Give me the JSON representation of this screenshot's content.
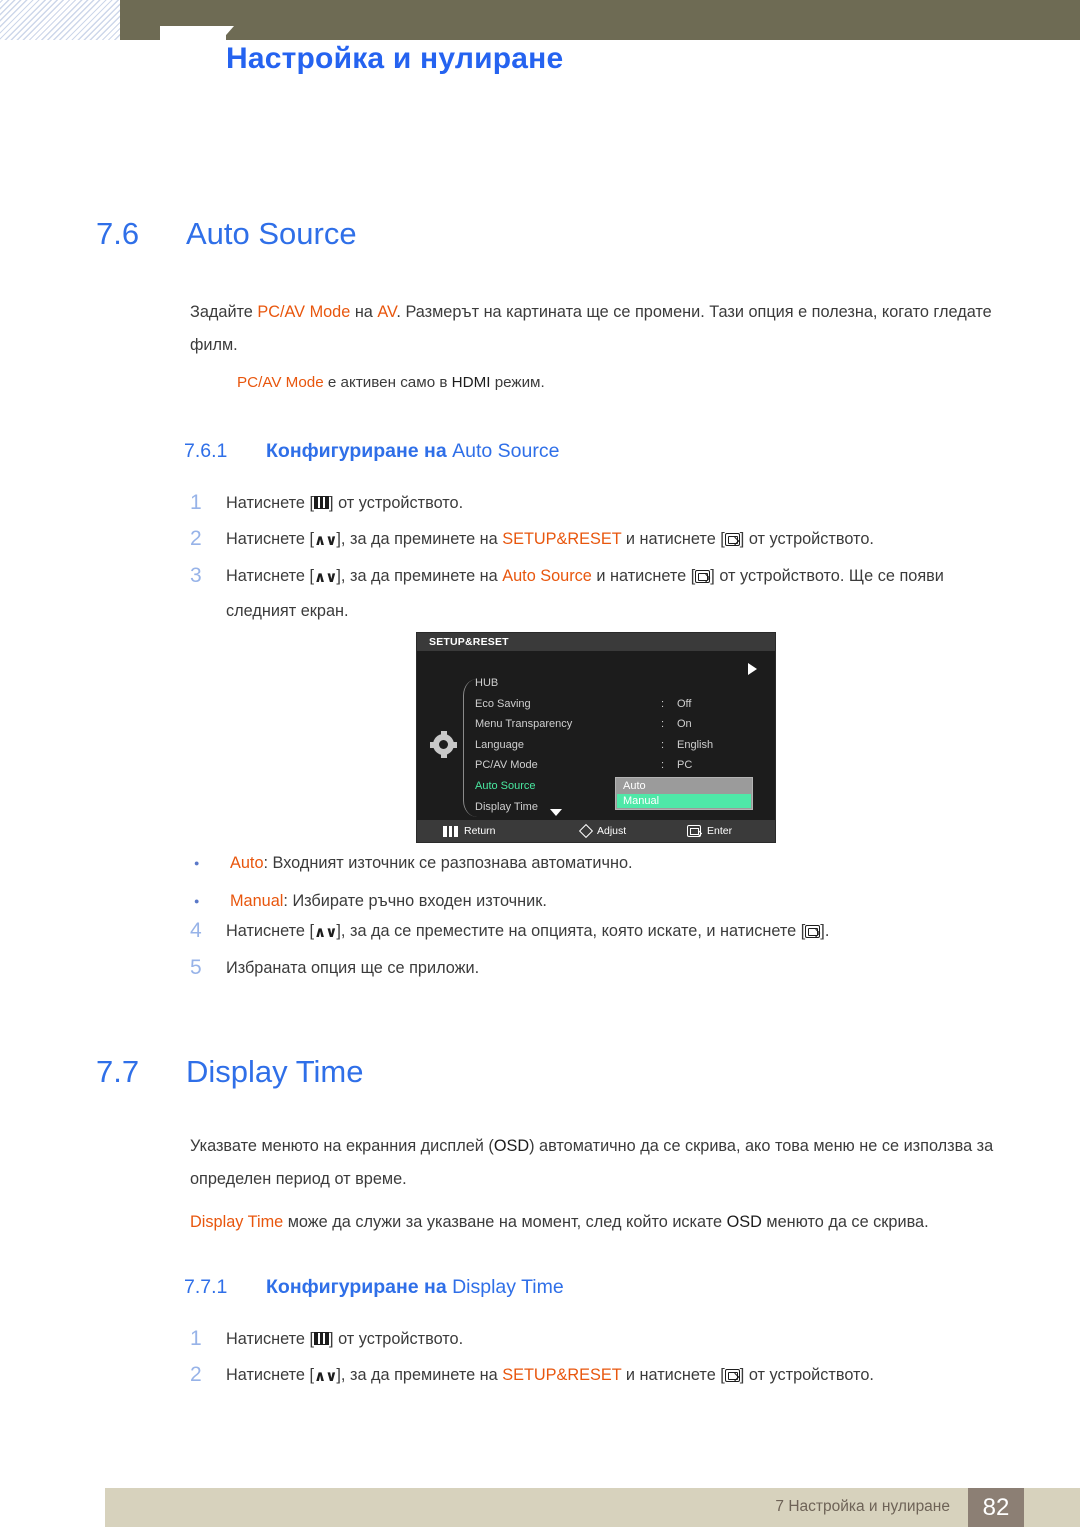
{
  "header": {
    "chapter_number": "7",
    "title": "Настройка и нулиране"
  },
  "sections": [
    {
      "number": "7.6",
      "title": "Auto Source",
      "paragraph_parts": [
        {
          "t": "Задайте ",
          "style": "normal"
        },
        {
          "t": "PC/AV Mode",
          "style": "orange"
        },
        {
          "t": " на ",
          "style": "normal"
        },
        {
          "t": "AV",
          "style": "orange"
        },
        {
          "t": ". Размерът на картината ще се промени. Тази опция е полезна, когато гледате филм.",
          "style": "normal"
        }
      ],
      "note_parts": [
        {
          "t": "PC/AV Mode",
          "style": "orange"
        },
        {
          "t": " е активен само в ",
          "style": "normal"
        },
        {
          "t": "HDMI",
          "style": "dark"
        },
        {
          "t": " режим.",
          "style": "normal"
        }
      ],
      "subsection": {
        "number": "7.6.1",
        "label_bg": "Конфигуриране на ",
        "label_latin": "Auto Source"
      }
    },
    {
      "number": "7.7",
      "title": "Display Time",
      "paragraph_parts": [
        {
          "t": "Указвате менюто на екранния дисплей (",
          "style": "normal"
        },
        {
          "t": "OSD",
          "style": "dark"
        },
        {
          "t": ") автоматично да се скрива, ако това меню не се използва за определен период от време.",
          "style": "normal"
        }
      ],
      "paragraph2_parts": [
        {
          "t": "Display Time",
          "style": "orange"
        },
        {
          "t": " може да служи за указване на момент, след който искате ",
          "style": "normal"
        },
        {
          "t": "OSD",
          "style": "dark"
        },
        {
          "t": " менюто да се скрива.",
          "style": "normal"
        }
      ],
      "subsection": {
        "number": "7.7.1",
        "label_bg": "Конфигуриране на ",
        "label_latin": "Display Time"
      }
    }
  ],
  "steps_76": [
    {
      "n": "1",
      "parts": [
        {
          "t": "Натиснете [",
          "style": "normal"
        },
        {
          "t": "menu-icon",
          "style": "icon-menu"
        },
        {
          "t": "] от устройството.",
          "style": "normal"
        }
      ]
    },
    {
      "n": "2",
      "parts": [
        {
          "t": "Натиснете [",
          "style": "normal"
        },
        {
          "t": "up-down-icon",
          "style": "icon-updown"
        },
        {
          "t": "], за да преминете на ",
          "style": "normal"
        },
        {
          "t": "SETUP&RESET",
          "style": "orange"
        },
        {
          "t": " и натиснете [",
          "style": "normal"
        },
        {
          "t": "enter-icon",
          "style": "icon-enter"
        },
        {
          "t": "] от устройството.",
          "style": "normal"
        }
      ]
    },
    {
      "n": "3",
      "parts": [
        {
          "t": "Натиснете [",
          "style": "normal"
        },
        {
          "t": "up-down-icon",
          "style": "icon-updown"
        },
        {
          "t": "], за да преминете на ",
          "style": "normal"
        },
        {
          "t": "Auto Source",
          "style": "orange"
        },
        {
          "t": " и натиснете [",
          "style": "normal"
        },
        {
          "t": "enter-icon",
          "style": "icon-enter"
        },
        {
          "t": "] от устройството. Ще се появи следният екран.",
          "style": "normal"
        }
      ]
    }
  ],
  "steps_76_after": [
    {
      "n": "4",
      "parts": [
        {
          "t": "Натиснете [",
          "style": "normal"
        },
        {
          "t": "up-down-icon",
          "style": "icon-updown"
        },
        {
          "t": "], за да се преместите на опцията, която искате, и натиснете [",
          "style": "normal"
        },
        {
          "t": "enter-icon",
          "style": "icon-enter"
        },
        {
          "t": "].",
          "style": "normal"
        }
      ]
    },
    {
      "n": "5",
      "parts": [
        {
          "t": "Избраната опция ще се приложи.",
          "style": "normal"
        }
      ]
    }
  ],
  "bullets_76": [
    {
      "parts": [
        {
          "t": "Auto",
          "style": "orange"
        },
        {
          "t": ": Входният източник се разпознава автоматично.",
          "style": "normal"
        }
      ]
    },
    {
      "parts": [
        {
          "t": "Manual",
          "style": "orange"
        },
        {
          "t": ": Избирате ръчно входен източник.",
          "style": "normal"
        }
      ]
    }
  ],
  "steps_77": [
    {
      "n": "1",
      "parts": [
        {
          "t": "Натиснете [",
          "style": "normal"
        },
        {
          "t": "menu-icon",
          "style": "icon-menu"
        },
        {
          "t": "] от устройството.",
          "style": "normal"
        }
      ]
    },
    {
      "n": "2",
      "parts": [
        {
          "t": "Натиснете [",
          "style": "normal"
        },
        {
          "t": "up-down-icon",
          "style": "icon-updown"
        },
        {
          "t": "], за да преминете на ",
          "style": "normal"
        },
        {
          "t": "SETUP&RESET",
          "style": "orange"
        },
        {
          "t": " и натиснете [",
          "style": "normal"
        },
        {
          "t": "enter-icon",
          "style": "icon-enter"
        },
        {
          "t": "] от устройството.",
          "style": "normal"
        }
      ]
    }
  ],
  "osd": {
    "title": "SETUP&RESET",
    "arrow_icon": "play-right-icon",
    "gear_icon": "gear-icon",
    "scroll_down_icon": "chevron-down-icon",
    "rows": [
      {
        "label": "HUB",
        "colon": "",
        "value": "",
        "selected": false
      },
      {
        "label": "Eco Saving",
        "colon": ":",
        "value": "Off",
        "selected": false
      },
      {
        "label": "Menu Transparency",
        "colon": ":",
        "value": "On",
        "selected": false
      },
      {
        "label": "Language",
        "colon": ":",
        "value": "English",
        "selected": false
      },
      {
        "label": "PC/AV Mode",
        "colon": ":",
        "value": "PC",
        "selected": false
      },
      {
        "label": "Auto Source",
        "colon": ":",
        "value": "",
        "selected": true
      },
      {
        "label": "Display Time",
        "colon": ":",
        "value": "",
        "selected": false
      }
    ],
    "dropdown": {
      "options": [
        "Auto",
        "Manual"
      ],
      "highlighted": "Manual",
      "highlight_color": "#4fe8a8",
      "background_color": "#9b9b9b"
    },
    "footer": [
      {
        "icon": "menu-bars-icon",
        "label": "Return"
      },
      {
        "icon": "diamond-icon",
        "label": "Adjust"
      },
      {
        "icon": "enter-key-icon",
        "label": "Enter"
      }
    ]
  },
  "footer": {
    "text": "7 Настройка и нулиране",
    "page_number": "82"
  },
  "colors": {
    "heading_blue": "#2f6fe8",
    "accent_orange": "#e8560d",
    "header_bar": "#6e6b54",
    "footer_band": "#d7d2bd",
    "footer_box": "#8c7f74",
    "step_number": "#97b3e8"
  }
}
